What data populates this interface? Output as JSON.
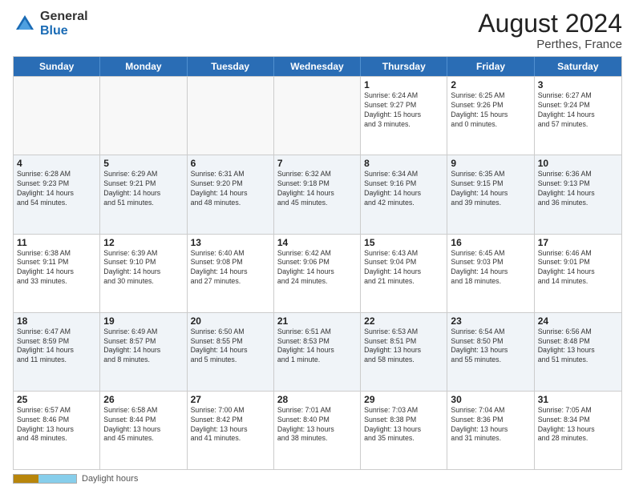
{
  "header": {
    "logo_general": "General",
    "logo_blue": "Blue",
    "month_year": "August 2024",
    "location": "Perthes, France"
  },
  "footer": {
    "label": "Daylight hours"
  },
  "weekdays": [
    "Sunday",
    "Monday",
    "Tuesday",
    "Wednesday",
    "Thursday",
    "Friday",
    "Saturday"
  ],
  "rows": [
    {
      "cells": [
        {
          "empty": true
        },
        {
          "empty": true
        },
        {
          "empty": true
        },
        {
          "empty": true
        },
        {
          "day": "1",
          "lines": [
            "Sunrise: 6:24 AM",
            "Sunset: 9:27 PM",
            "Daylight: 15 hours",
            "and 3 minutes."
          ]
        },
        {
          "day": "2",
          "lines": [
            "Sunrise: 6:25 AM",
            "Sunset: 9:26 PM",
            "Daylight: 15 hours",
            "and 0 minutes."
          ]
        },
        {
          "day": "3",
          "lines": [
            "Sunrise: 6:27 AM",
            "Sunset: 9:24 PM",
            "Daylight: 14 hours",
            "and 57 minutes."
          ]
        }
      ]
    },
    {
      "alt": true,
      "cells": [
        {
          "day": "4",
          "lines": [
            "Sunrise: 6:28 AM",
            "Sunset: 9:23 PM",
            "Daylight: 14 hours",
            "and 54 minutes."
          ]
        },
        {
          "day": "5",
          "lines": [
            "Sunrise: 6:29 AM",
            "Sunset: 9:21 PM",
            "Daylight: 14 hours",
            "and 51 minutes."
          ]
        },
        {
          "day": "6",
          "lines": [
            "Sunrise: 6:31 AM",
            "Sunset: 9:20 PM",
            "Daylight: 14 hours",
            "and 48 minutes."
          ]
        },
        {
          "day": "7",
          "lines": [
            "Sunrise: 6:32 AM",
            "Sunset: 9:18 PM",
            "Daylight: 14 hours",
            "and 45 minutes."
          ]
        },
        {
          "day": "8",
          "lines": [
            "Sunrise: 6:34 AM",
            "Sunset: 9:16 PM",
            "Daylight: 14 hours",
            "and 42 minutes."
          ]
        },
        {
          "day": "9",
          "lines": [
            "Sunrise: 6:35 AM",
            "Sunset: 9:15 PM",
            "Daylight: 14 hours",
            "and 39 minutes."
          ]
        },
        {
          "day": "10",
          "lines": [
            "Sunrise: 6:36 AM",
            "Sunset: 9:13 PM",
            "Daylight: 14 hours",
            "and 36 minutes."
          ]
        }
      ]
    },
    {
      "cells": [
        {
          "day": "11",
          "lines": [
            "Sunrise: 6:38 AM",
            "Sunset: 9:11 PM",
            "Daylight: 14 hours",
            "and 33 minutes."
          ]
        },
        {
          "day": "12",
          "lines": [
            "Sunrise: 6:39 AM",
            "Sunset: 9:10 PM",
            "Daylight: 14 hours",
            "and 30 minutes."
          ]
        },
        {
          "day": "13",
          "lines": [
            "Sunrise: 6:40 AM",
            "Sunset: 9:08 PM",
            "Daylight: 14 hours",
            "and 27 minutes."
          ]
        },
        {
          "day": "14",
          "lines": [
            "Sunrise: 6:42 AM",
            "Sunset: 9:06 PM",
            "Daylight: 14 hours",
            "and 24 minutes."
          ]
        },
        {
          "day": "15",
          "lines": [
            "Sunrise: 6:43 AM",
            "Sunset: 9:04 PM",
            "Daylight: 14 hours",
            "and 21 minutes."
          ]
        },
        {
          "day": "16",
          "lines": [
            "Sunrise: 6:45 AM",
            "Sunset: 9:03 PM",
            "Daylight: 14 hours",
            "and 18 minutes."
          ]
        },
        {
          "day": "17",
          "lines": [
            "Sunrise: 6:46 AM",
            "Sunset: 9:01 PM",
            "Daylight: 14 hours",
            "and 14 minutes."
          ]
        }
      ]
    },
    {
      "alt": true,
      "cells": [
        {
          "day": "18",
          "lines": [
            "Sunrise: 6:47 AM",
            "Sunset: 8:59 PM",
            "Daylight: 14 hours",
            "and 11 minutes."
          ]
        },
        {
          "day": "19",
          "lines": [
            "Sunrise: 6:49 AM",
            "Sunset: 8:57 PM",
            "Daylight: 14 hours",
            "and 8 minutes."
          ]
        },
        {
          "day": "20",
          "lines": [
            "Sunrise: 6:50 AM",
            "Sunset: 8:55 PM",
            "Daylight: 14 hours",
            "and 5 minutes."
          ]
        },
        {
          "day": "21",
          "lines": [
            "Sunrise: 6:51 AM",
            "Sunset: 8:53 PM",
            "Daylight: 14 hours",
            "and 1 minute."
          ]
        },
        {
          "day": "22",
          "lines": [
            "Sunrise: 6:53 AM",
            "Sunset: 8:51 PM",
            "Daylight: 13 hours",
            "and 58 minutes."
          ]
        },
        {
          "day": "23",
          "lines": [
            "Sunrise: 6:54 AM",
            "Sunset: 8:50 PM",
            "Daylight: 13 hours",
            "and 55 minutes."
          ]
        },
        {
          "day": "24",
          "lines": [
            "Sunrise: 6:56 AM",
            "Sunset: 8:48 PM",
            "Daylight: 13 hours",
            "and 51 minutes."
          ]
        }
      ]
    },
    {
      "cells": [
        {
          "day": "25",
          "lines": [
            "Sunrise: 6:57 AM",
            "Sunset: 8:46 PM",
            "Daylight: 13 hours",
            "and 48 minutes."
          ]
        },
        {
          "day": "26",
          "lines": [
            "Sunrise: 6:58 AM",
            "Sunset: 8:44 PM",
            "Daylight: 13 hours",
            "and 45 minutes."
          ]
        },
        {
          "day": "27",
          "lines": [
            "Sunrise: 7:00 AM",
            "Sunset: 8:42 PM",
            "Daylight: 13 hours",
            "and 41 minutes."
          ]
        },
        {
          "day": "28",
          "lines": [
            "Sunrise: 7:01 AM",
            "Sunset: 8:40 PM",
            "Daylight: 13 hours",
            "and 38 minutes."
          ]
        },
        {
          "day": "29",
          "lines": [
            "Sunrise: 7:03 AM",
            "Sunset: 8:38 PM",
            "Daylight: 13 hours",
            "and 35 minutes."
          ]
        },
        {
          "day": "30",
          "lines": [
            "Sunrise: 7:04 AM",
            "Sunset: 8:36 PM",
            "Daylight: 13 hours",
            "and 31 minutes."
          ]
        },
        {
          "day": "31",
          "lines": [
            "Sunrise: 7:05 AM",
            "Sunset: 8:34 PM",
            "Daylight: 13 hours",
            "and 28 minutes."
          ]
        }
      ]
    }
  ]
}
